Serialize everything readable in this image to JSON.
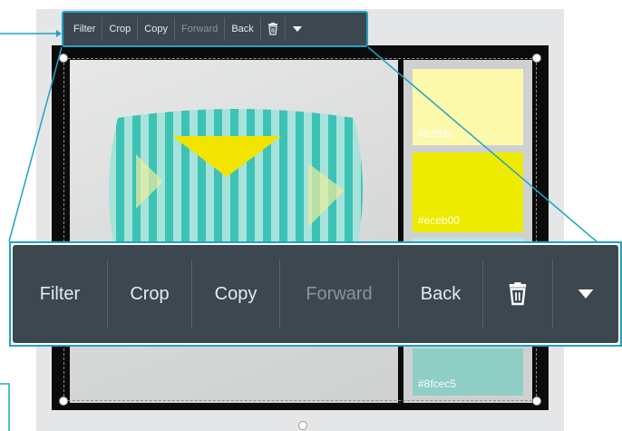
{
  "toolbar": {
    "items": [
      {
        "label": "Filter",
        "enabled": true
      },
      {
        "label": "Crop",
        "enabled": true
      },
      {
        "label": "Copy",
        "enabled": true
      },
      {
        "label": "Forward",
        "enabled": false
      },
      {
        "label": "Back",
        "enabled": true
      }
    ],
    "delete_icon": "trash-icon",
    "more_icon": "caret-down-icon"
  },
  "swatches": [
    {
      "hex": "#fcf9ac",
      "label": "#fcf9ac"
    },
    {
      "hex": "#eceb00",
      "label": "#eceb00"
    },
    {
      "hex": "#bfe6e3",
      "label": ""
    },
    {
      "hex": "#8fcec5",
      "label": "#8fcec5"
    }
  ],
  "colors": {
    "accent": "#21a3c2",
    "toolbar_bg": "#3c4750"
  }
}
